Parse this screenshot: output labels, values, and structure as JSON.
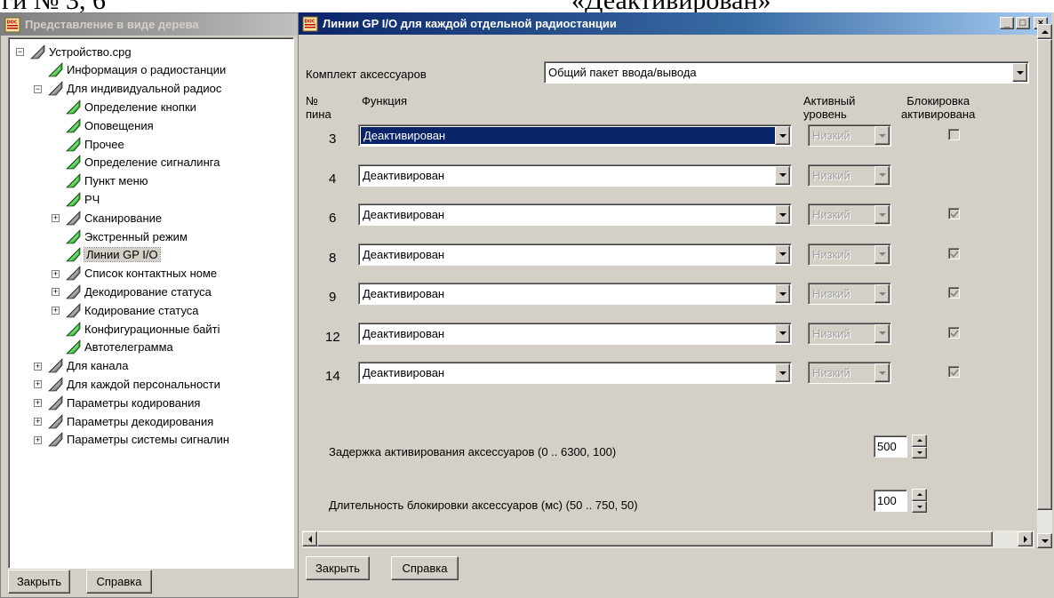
{
  "doc_fragment": {
    "left": "ги № 3, 6",
    "right": "«Деактивирован»"
  },
  "tree_window": {
    "title": "Представление в виде дерева",
    "nodes": [
      {
        "label": "Устройство.cpg",
        "expander": "−"
      },
      {
        "label": "Информация о радиостанции"
      },
      {
        "label": "Для индивидуальной радиос",
        "expander": "−"
      },
      {
        "label": "Определение кнопки"
      },
      {
        "label": "Оповещения"
      },
      {
        "label": "Прочее"
      },
      {
        "label": "Определение сигналинга"
      },
      {
        "label": "Пункт меню"
      },
      {
        "label": "РЧ"
      },
      {
        "label": "Сканирование",
        "expander": "+"
      },
      {
        "label": "Экстренный режим"
      },
      {
        "label": "Линии GP I/O",
        "selected": true
      },
      {
        "label": "Список контактных номе",
        "expander": "+"
      },
      {
        "label": "Декодирование статуса",
        "expander": "+"
      },
      {
        "label": "Кодирование статуса",
        "expander": "+"
      },
      {
        "label": "Конфигурационные байті"
      },
      {
        "label": "Автотелеграмма"
      },
      {
        "label": "Для канала",
        "expander": "+"
      },
      {
        "label": "Для каждой персональности",
        "expander": "+"
      },
      {
        "label": "Параметры кодирования",
        "expander": "+"
      },
      {
        "label": "Параметры  декодирования",
        "expander": "+"
      },
      {
        "label": "Параметры системы сигналин",
        "expander": "+"
      }
    ],
    "close_button": "Закрыть",
    "help_button": "Справка"
  },
  "main_window": {
    "title": "Линии GP I/O для каждой отдельной радиостанции",
    "caption_buttons": {
      "minimize": "_",
      "maximize": "□",
      "close": "×"
    },
    "accessory_kit_label": "Комплект аксессуаров",
    "accessory_kit_value": "Общий пакет ввода/вывода",
    "columns": {
      "pin_line1": "№",
      "pin_line2": "пина",
      "function": "Функция",
      "active_level_line1": "Активный",
      "active_level_line2": "уровень",
      "lock_line1": "Блокировка",
      "lock_line2": "активирована"
    },
    "rows": [
      {
        "pin": "3",
        "function": "Деактивирован",
        "level": "Низкий",
        "lock": "unchecked",
        "focused": true
      },
      {
        "pin": "4",
        "function": "Деактивирован",
        "level": "Низкий",
        "lock": "none"
      },
      {
        "pin": "6",
        "function": "Деактивирован",
        "level": "Низкий",
        "lock": "checked"
      },
      {
        "pin": "8",
        "function": "Деактивирован",
        "level": "Низкий",
        "lock": "checked"
      },
      {
        "pin": "9",
        "function": "Деактивирован",
        "level": "Низкий",
        "lock": "checked"
      },
      {
        "pin": "12",
        "function": "Деактивирован",
        "level": "Низкий",
        "lock": "checked"
      },
      {
        "pin": "14",
        "function": "Деактивирован",
        "level": "Низкий",
        "lock": "checked"
      }
    ],
    "activation_delay_label": "Задержка активирования аксессуаров (0 .. 6300, 100)",
    "activation_delay_value": "500",
    "lock_duration_label": "Длительность блокировки аксессуаров (мс) (50 .. 750, 50)",
    "lock_duration_value": "100",
    "close_button": "Закрыть",
    "help_button": "Справка"
  },
  "colors": {
    "window_bg": "#d4d0c8",
    "title_active": "#0a246a",
    "title_inactive": "#808080",
    "selection": "#0a246a",
    "tree_icon_green": "#2db82d"
  },
  "icons": [
    "app-icon",
    "tree-node-icon",
    "dropdown-arrow-icon",
    "spin-up-icon",
    "spin-down-icon",
    "checkbox-icon",
    "scroll-arrow-icon"
  ]
}
